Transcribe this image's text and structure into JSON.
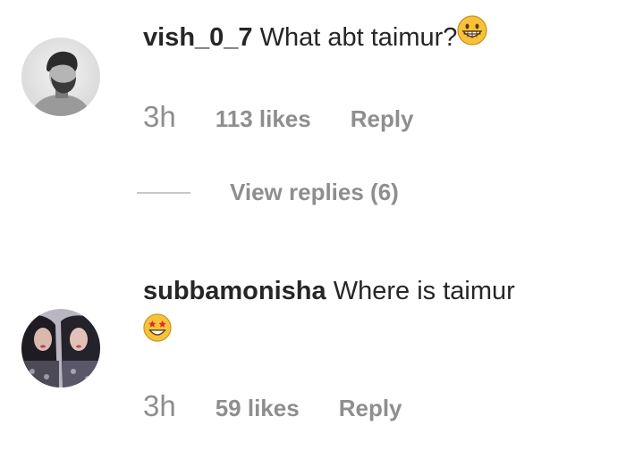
{
  "comments": [
    {
      "username": "vish_0_7",
      "text": "What abt taimur?",
      "emoji": "grinning-face-emoji",
      "time": "3h",
      "likes": "113 likes",
      "reply_label": "Reply",
      "view_replies_label": "View replies (6)"
    },
    {
      "username": "subbamonisha",
      "text": "Where is taimur",
      "emoji": "star-struck-face-emoji",
      "time": "3h",
      "likes": "59 likes",
      "reply_label": "Reply"
    }
  ],
  "colors": {
    "primary_text": "#262626",
    "secondary_text": "#8e8e8e",
    "divider": "#c7c7c7",
    "emoji_yellow": "#f7c23a"
  }
}
